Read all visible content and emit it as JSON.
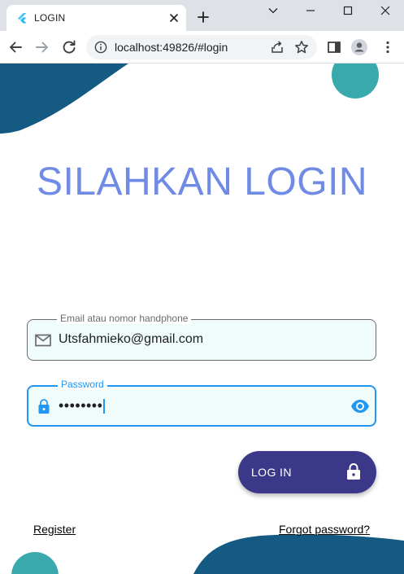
{
  "browser": {
    "tab": {
      "title": "LOGIN"
    },
    "address_bar": {
      "url": "localhost:49826/#login"
    },
    "icons": [
      "flutter-favicon",
      "close-icon",
      "plus-icon",
      "chevron-down-icon",
      "minimize-icon",
      "maximize-icon",
      "window-close-icon",
      "back-arrow-icon",
      "forward-arrow-icon",
      "reload-icon",
      "info-icon",
      "share-icon",
      "star-icon",
      "sidebar-icon",
      "profile-icon",
      "more-vert-icon"
    ]
  },
  "login": {
    "title": "SILAHKAN LOGIN",
    "email": {
      "label": "Email atau nomor handphone",
      "value": "Utsfahmieko@gmail.com",
      "icon": "mail-icon"
    },
    "password": {
      "label": "Password",
      "value": "••••••••",
      "icon": "lock-icon",
      "toggle_icon": "eye-icon"
    },
    "submit": {
      "label": "LOG IN",
      "icon": "lock-icon"
    },
    "register_link": "Register",
    "forgot_link": "Forgot password?"
  },
  "colors": {
    "title": "#6f8be6",
    "wave_dark": "#145a83",
    "circle_teal": "#3aa9ad",
    "button": "#3c3889",
    "focus_blue": "#2196f3",
    "field_fill": "#f0fbfb"
  }
}
